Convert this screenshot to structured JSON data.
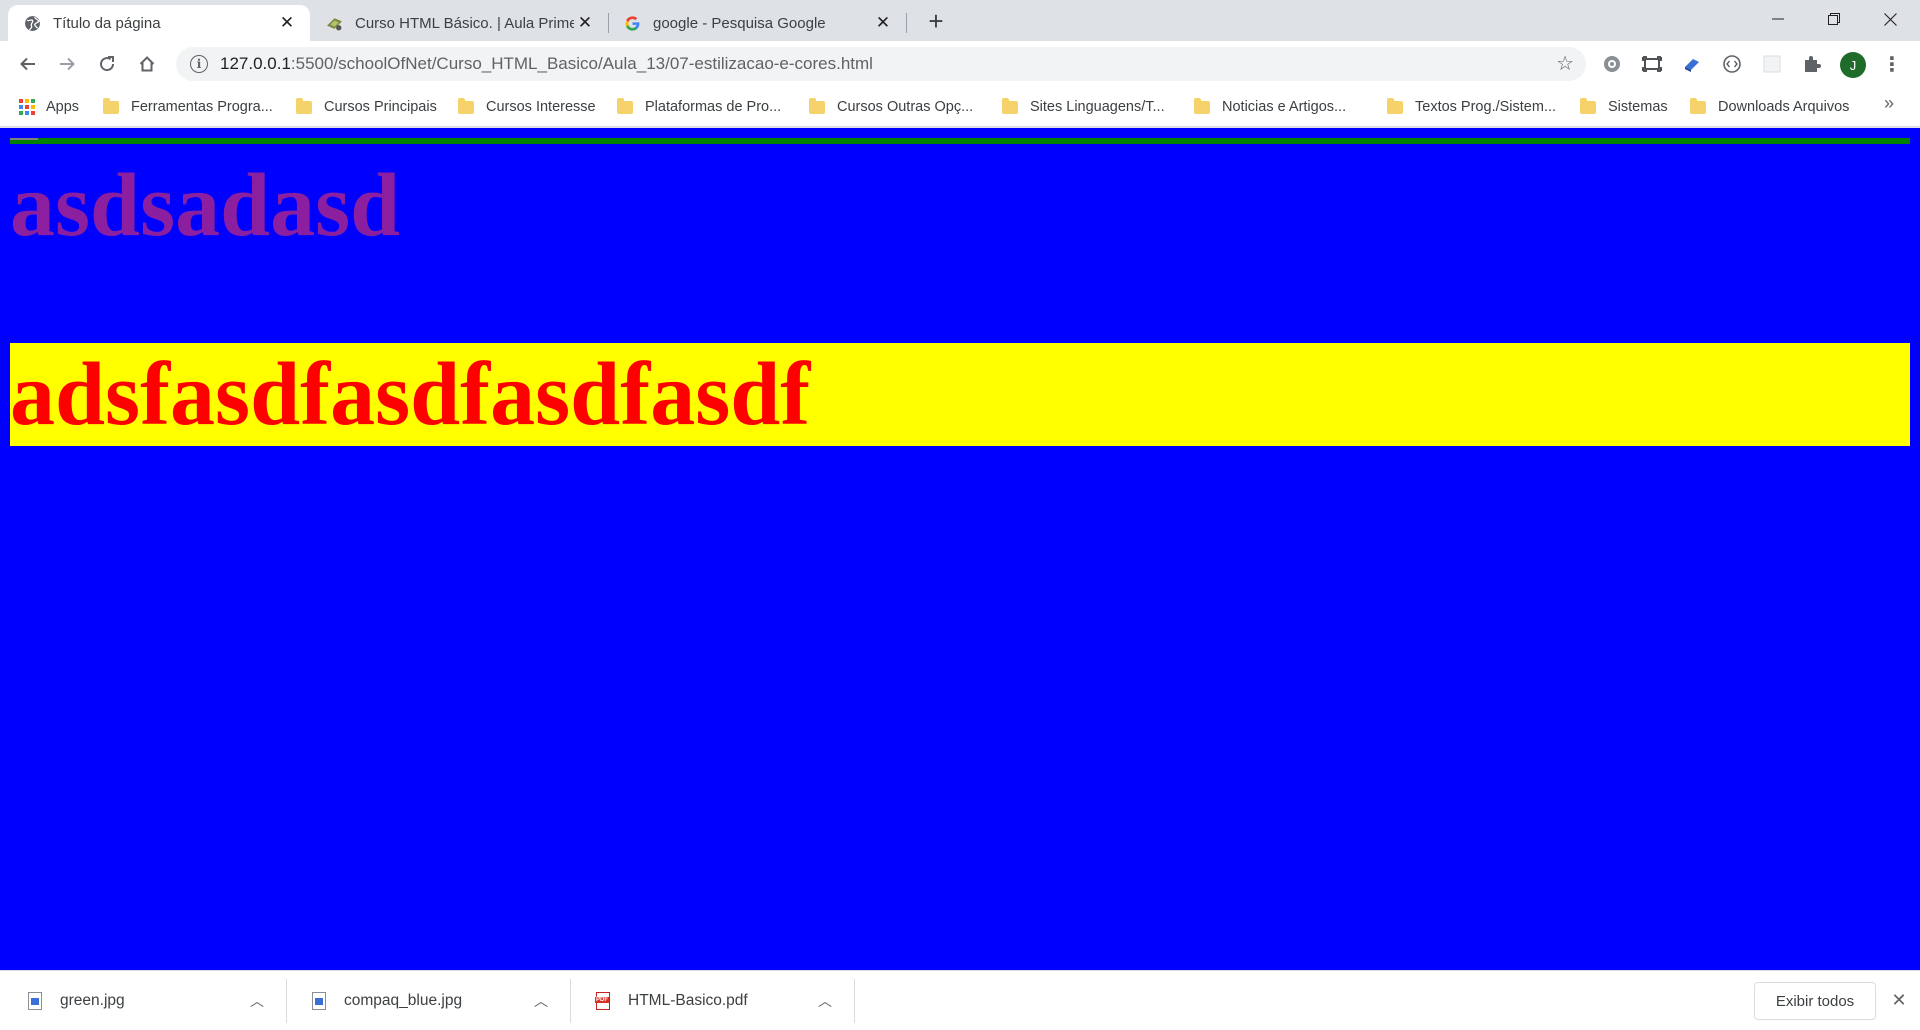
{
  "tabs": [
    {
      "title": "Título da página",
      "icon": "globe-icon"
    },
    {
      "title": "Curso HTML Básico. | Aula Primeira",
      "icon": "school-of-net-icon"
    },
    {
      "title": "google - Pesquisa Google",
      "icon": "google-icon"
    }
  ],
  "address_bar": {
    "host": "127.0.0.1",
    "path": ":5500/schoolOfNet/Curso_HTML_Basico/Aula_13/07-estilizacao-e-cores.html"
  },
  "profile_initial": "J",
  "bookmarks": {
    "apps": "Apps",
    "items": [
      "Ferramentas Progra...",
      "Cursos Principais",
      "Cursos Interesse",
      "Plataformas de Pro...",
      "Cursos Outras Opç...",
      "Sites Linguagens/T...",
      "Noticias e Artigos...",
      "Textos Prog./Sistem...",
      "Sistemas",
      "Downloads Arquivos"
    ],
    "overflow": "»"
  },
  "page": {
    "background_color": "#0000ff",
    "rule_color": "#008000",
    "heading1": "asdsadasd",
    "heading1_color": "#8b1fa0",
    "heading2": "adsfasdfasdfasdfasdf",
    "heading2_color": "#ff0000",
    "heading2_background": "#ffff00"
  },
  "downloads": {
    "items": [
      {
        "name": "green.jpg",
        "icon": "image-file-icon"
      },
      {
        "name": "compaq_blue.jpg",
        "icon": "image-file-icon"
      },
      {
        "name": "HTML-Basico.pdf",
        "icon": "pdf-file-icon"
      }
    ],
    "show_all": "Exibir todos"
  }
}
